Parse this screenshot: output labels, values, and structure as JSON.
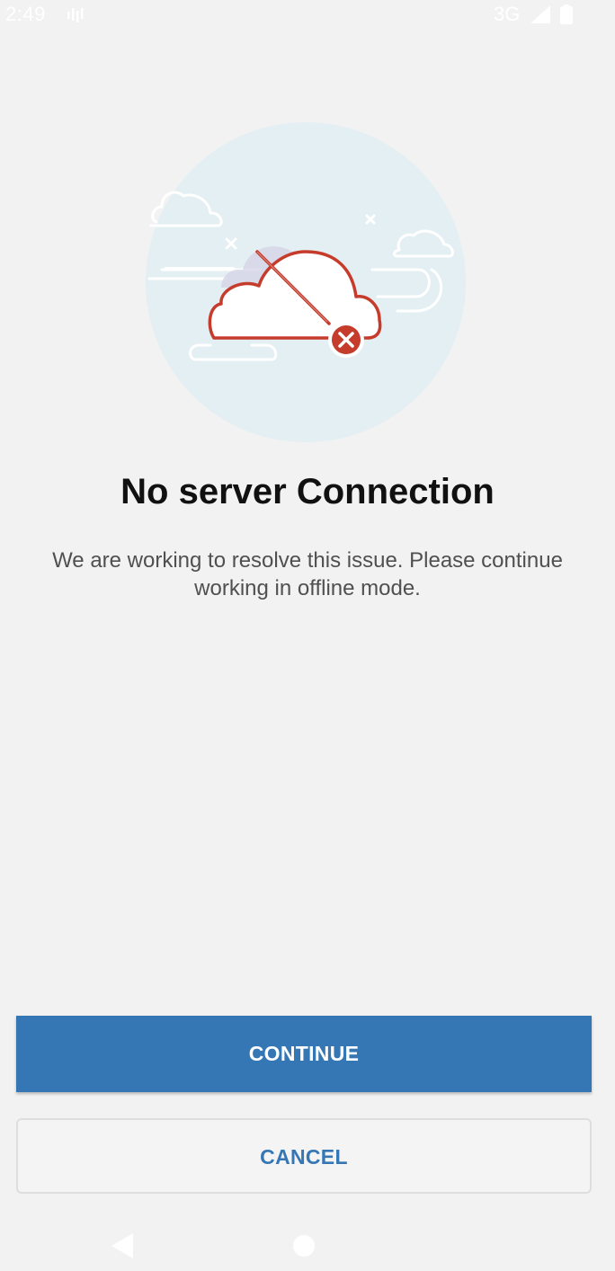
{
  "status_bar": {
    "time": "2:49",
    "network": "3G",
    "notification_icon": "signal-bars-notification-icon",
    "signal_icon": "cellular-signal-icon",
    "battery_icon": "battery-icon"
  },
  "illustration": {
    "icon": "cloud-disconnected-icon",
    "error_icon": "error-x-icon",
    "colors": {
      "circle_bg": "#e4eff3",
      "cloud_stroke": "#c63c2c",
      "cloud_shadow": "#d4d4e6",
      "error_fill": "#c63c2c"
    }
  },
  "dialog": {
    "title": "No server Connection",
    "message": "We are working to resolve this issue. Please continue working in offline mode."
  },
  "actions": {
    "continue_label": "CONTINUE",
    "cancel_label": "CANCEL"
  },
  "nav_bar": {
    "back_icon": "back-triangle-icon",
    "home_icon": "home-circle-icon"
  },
  "colors": {
    "background": "#f2f2f2",
    "primary": "#3577b5",
    "title_text": "#111111",
    "body_text": "#505050"
  }
}
